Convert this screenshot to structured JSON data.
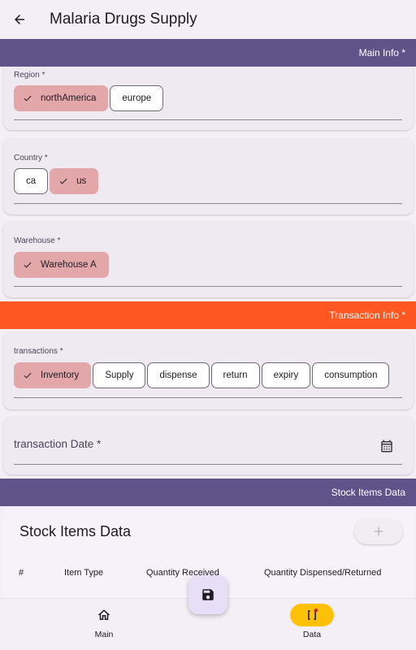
{
  "app_bar": {
    "title": "Malaria Drugs Supply"
  },
  "sections": {
    "main_info": "Main Info *",
    "transaction_info": "Transaction Info *",
    "stock_items": "Stock Items Data"
  },
  "region": {
    "label": "Region *",
    "options": [
      {
        "label": "northAmerica",
        "selected": true
      },
      {
        "label": "europe",
        "selected": false
      }
    ]
  },
  "country": {
    "label": "Country *",
    "options": [
      {
        "label": "ca",
        "selected": false
      },
      {
        "label": "us",
        "selected": true
      }
    ]
  },
  "warehouse": {
    "label": "Warehouse *",
    "options": [
      {
        "label": "Warehouse A",
        "selected": true
      }
    ]
  },
  "transactions": {
    "label": "transactions *",
    "options": [
      {
        "label": "Inventory",
        "selected": true
      },
      {
        "label": "Supply",
        "selected": false
      },
      {
        "label": "dispense",
        "selected": false
      },
      {
        "label": "return",
        "selected": false
      },
      {
        "label": "expiry",
        "selected": false
      },
      {
        "label": "consumption",
        "selected": false
      }
    ]
  },
  "transaction_date": {
    "label": "transaction Date *",
    "icon": "calendar-icon"
  },
  "stock_table": {
    "title": "Stock Items Data",
    "add_icon": "plus-icon",
    "columns": [
      "#",
      "Item Type",
      "Quantity Received",
      "Quantity Dispensed/Returned"
    ]
  },
  "fab": {
    "icon": "save-icon"
  },
  "bottom_nav": {
    "items": [
      {
        "label": "Main",
        "icon": "home-icon",
        "active": false
      },
      {
        "label": "Data",
        "icon": "data-array-icon",
        "active": true
      }
    ]
  },
  "colors": {
    "primary_header": "#60538a",
    "transaction_header": "#ff5722",
    "selected_chip": "#e3a7aa",
    "active_nav": "#ffc107"
  }
}
